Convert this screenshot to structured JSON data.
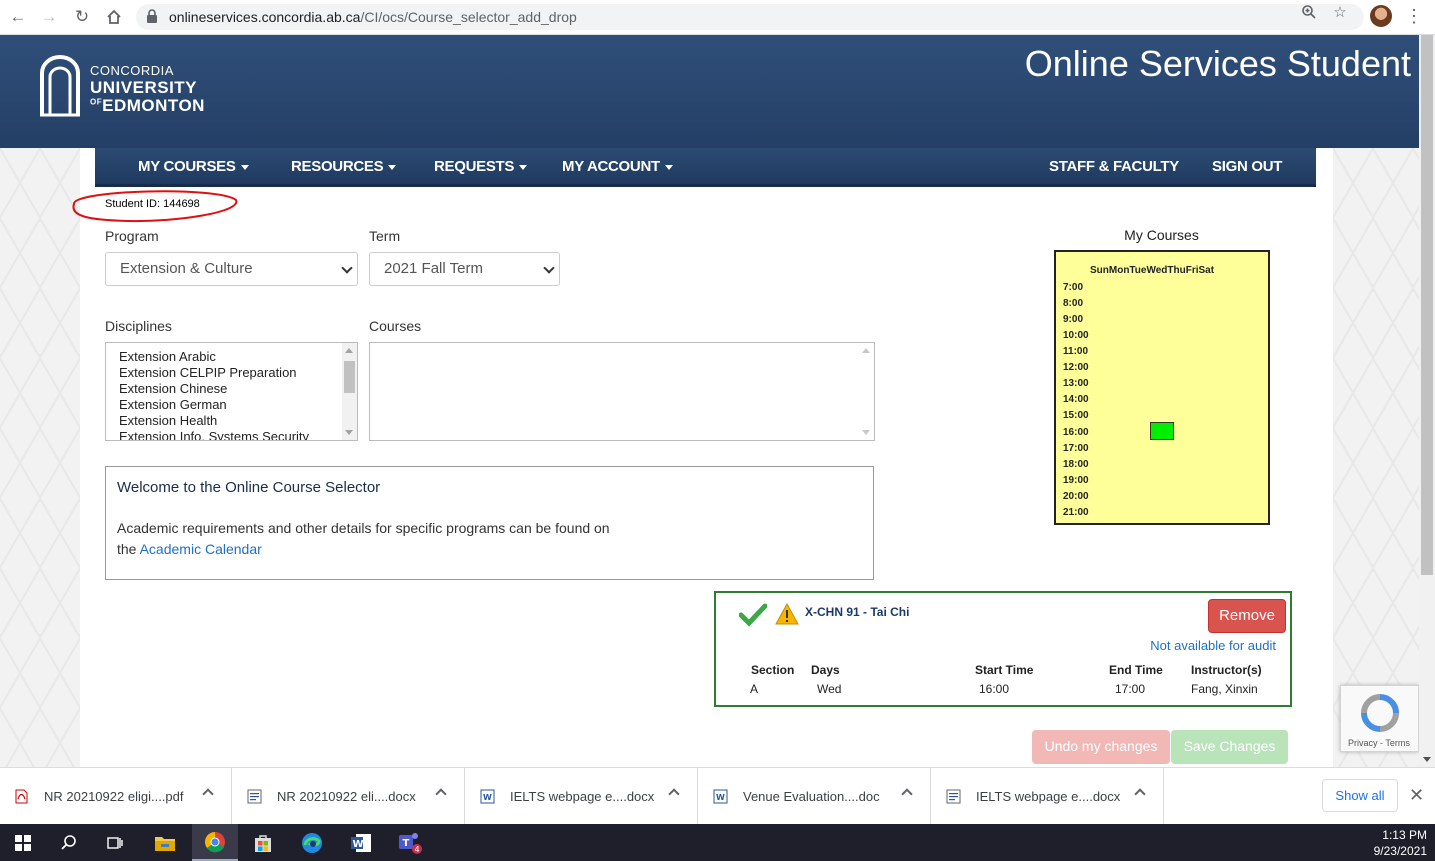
{
  "browser": {
    "url_host": "onlineservices.concordia.ab.ca",
    "url_path": "/CI/ocs/Course_selector_add_drop"
  },
  "header": {
    "logo_line1": "CONCORDIA",
    "logo_line2": "UNIVERSITY",
    "logo_of": "OF",
    "logo_line3": "EDMONTON",
    "site_title": "Online Services Student"
  },
  "menu": {
    "my_courses": "MY COURSES",
    "resources": "RESOURCES",
    "requests": "REQUESTS",
    "my_account": "MY ACCOUNT",
    "staff_faculty": "STAFF & FACULTY",
    "sign_out": "SIGN OUT"
  },
  "student": {
    "id_text": "Student ID: 144698"
  },
  "form": {
    "program_label": "Program",
    "program_value": "Extension & Culture",
    "term_label": "Term",
    "term_value": "2021 Fall Term",
    "disciplines_label": "Disciplines",
    "disciplines": [
      "Extension Arabic",
      "Extension CELPIP Preparation",
      "Extension Chinese",
      "Extension German",
      "Extension Health",
      "Extension Info. Systems Security"
    ],
    "courses_label": "Courses"
  },
  "welcome": {
    "title": "Welcome to the Online Course Selector",
    "line1": "Academic requirements and other details for specific programs can be found on",
    "line2_prefix": "the ",
    "link": "Academic Calendar"
  },
  "schedule": {
    "label": "My Courses",
    "days": "SunMonTueWedThuFriSat",
    "hours": [
      "7:00",
      "8:00",
      "9:00",
      "10:00",
      "11:00",
      "12:00",
      "13:00",
      "14:00",
      "15:00",
      "16:00",
      "17:00",
      "18:00",
      "19:00",
      "20:00",
      "21:00"
    ],
    "block_color": "#00ee00"
  },
  "course": {
    "title": "X-CHN 91 - Tai Chi",
    "remove": "Remove",
    "audit": "Not available for audit",
    "headers": {
      "section": "Section",
      "days": "Days",
      "start": "Start Time",
      "end": "End Time",
      "instructor": "Instructor(s)"
    },
    "values": {
      "section": "A",
      "days": "Wed",
      "start": "16:00",
      "end": "17:00",
      "instructor": "Fang, Xinxin"
    }
  },
  "actions": {
    "undo": "Undo my changes",
    "save": "Save Changes"
  },
  "recaptcha": {
    "links": "Privacy - Terms"
  },
  "downloads": {
    "items": [
      {
        "name": "NR 20210922 eligi....pdf",
        "type": "pdf"
      },
      {
        "name": "NR 20210922 eli....docx",
        "type": "doc"
      },
      {
        "name": "IELTS webpage e....docx",
        "type": "word"
      },
      {
        "name": "Venue Evaluation....doc",
        "type": "word"
      },
      {
        "name": "IELTS webpage e....docx",
        "type": "doc"
      }
    ],
    "show_all": "Show all"
  },
  "taskbar": {
    "time": "1:13 PM",
    "date": "9/23/2021",
    "teams_badge": "4"
  },
  "colors": {
    "header": "#2f4f79",
    "menubar": "#1f3a5f",
    "schedule_bg": "#ffff99",
    "remove": "#d9534f",
    "card_border": "#2e7d32"
  }
}
